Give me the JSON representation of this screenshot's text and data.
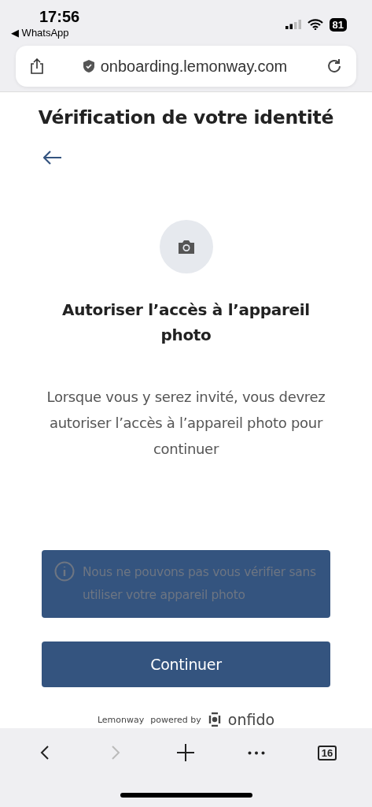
{
  "status_bar": {
    "time": "17:56",
    "back_app": "◀ WhatsApp",
    "battery": "81"
  },
  "address_bar": {
    "url": "onboarding.lemonway.com"
  },
  "page": {
    "title": "Vérification de votre identité",
    "heading": "Autoriser l’accès à l’appareil photo",
    "description": "Lorsque vous y serez invité, vous devrez autoriser l’accès à l’appareil photo pour continuer",
    "notice": "Nous ne pouvons pas vous vérifier sans utiliser votre appareil photo",
    "button": "Continuer",
    "footer_brand": "Lemonway",
    "footer_powered": "powered by",
    "footer_logo": "onfido"
  },
  "toolbar": {
    "items": [
      {
        "kind": "back",
        "disabled": false
      },
      {
        "kind": "forward",
        "disabled": true
      },
      {
        "kind": "new-tab",
        "disabled": false
      },
      {
        "kind": "more",
        "disabled": false
      },
      {
        "kind": "tabs",
        "disabled": false,
        "count": "16"
      }
    ]
  }
}
